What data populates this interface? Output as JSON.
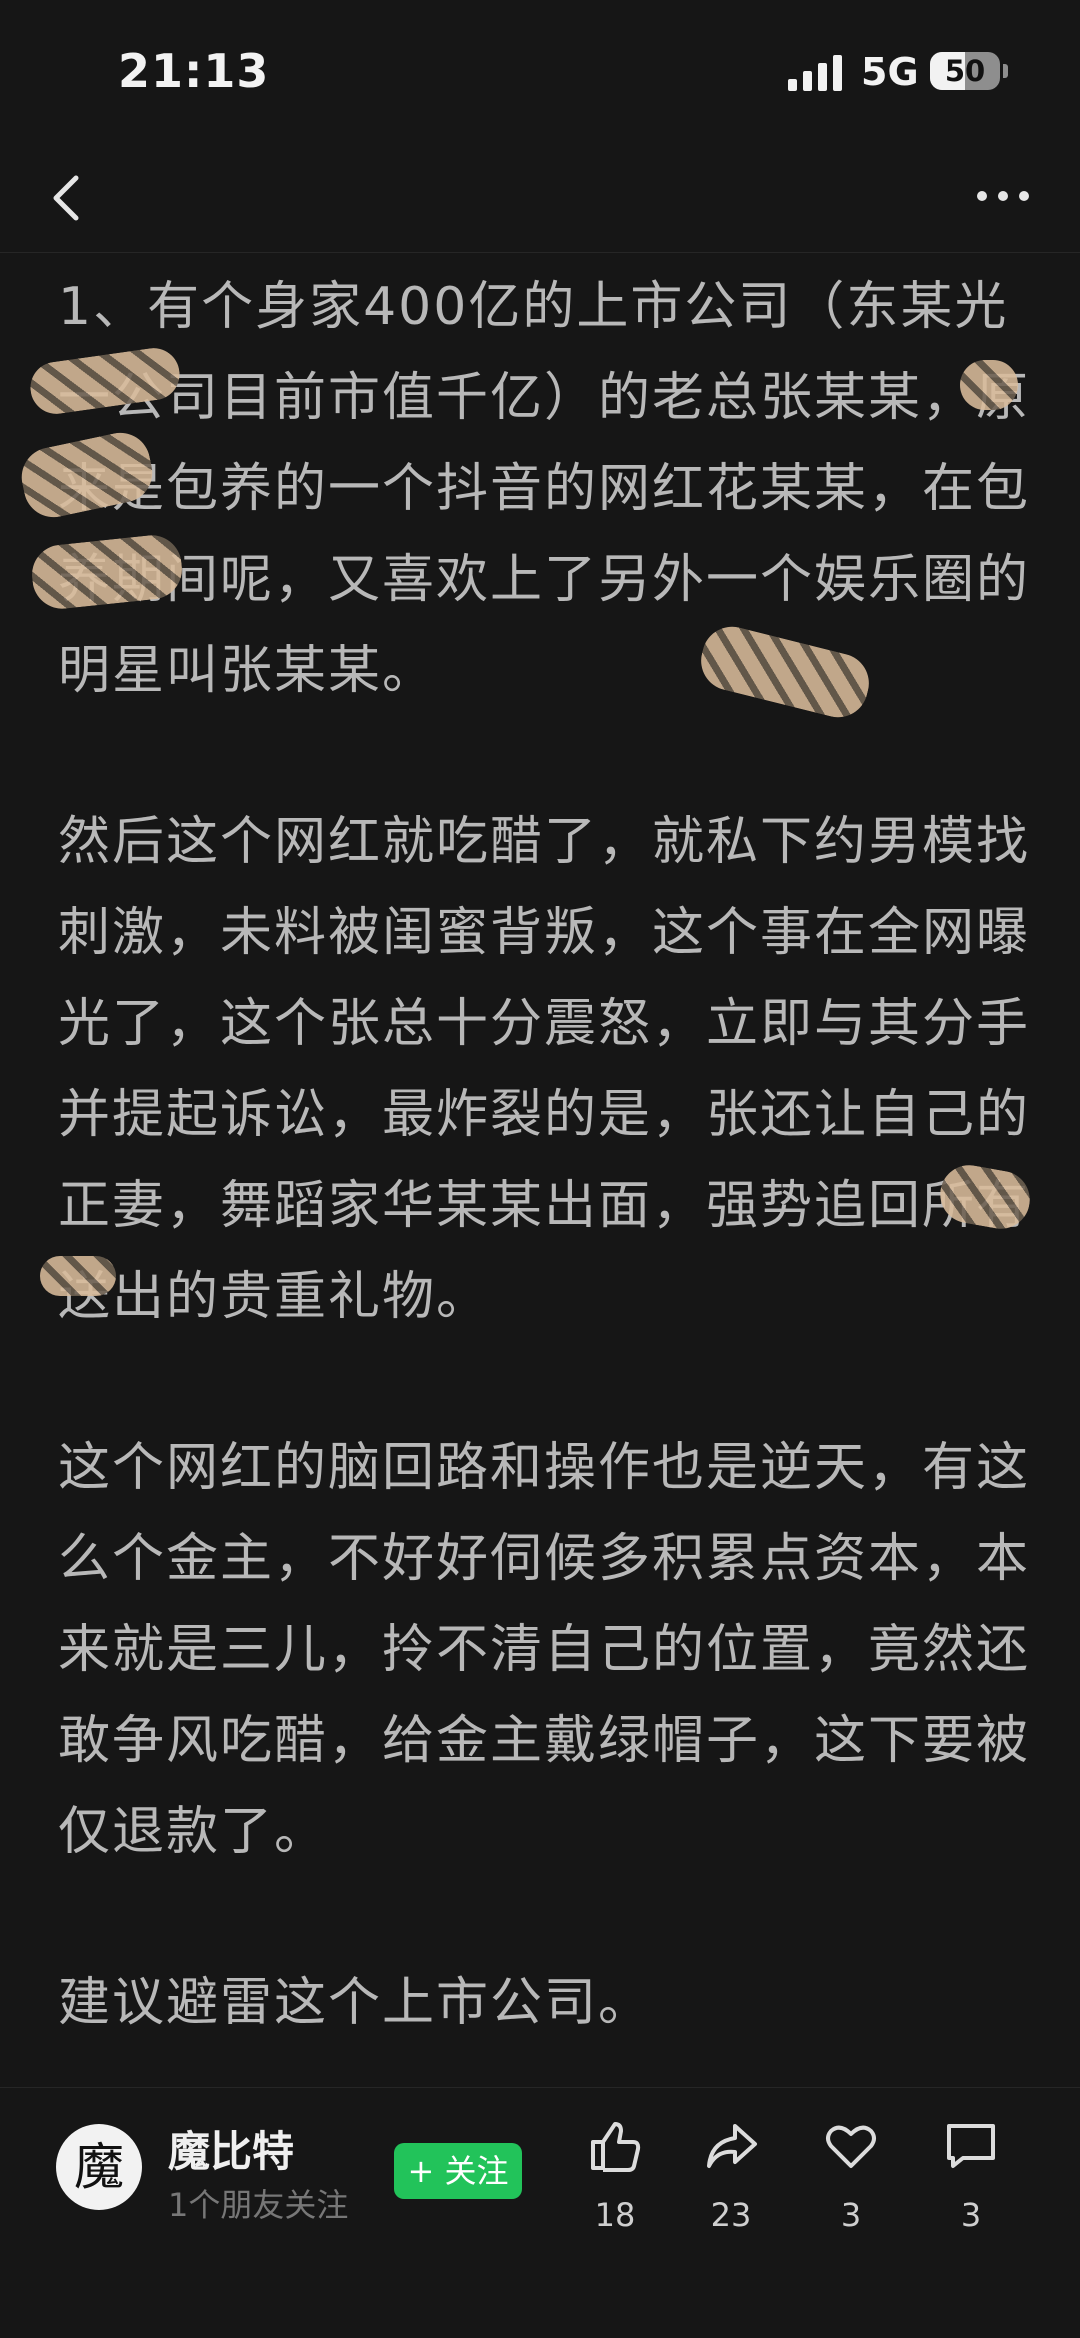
{
  "status_bar": {
    "time": "21:13",
    "network": "5G",
    "battery": "50",
    "battery_level": 0.5
  },
  "nav": {
    "back_icon": "chevron-left-icon",
    "more_icon": "more-dots-icon"
  },
  "article": {
    "paragraphs": [
      "1、有个身家400亿的上市公司（东某光一公司目前市值千亿）的老总张某某，原来是包养的一个抖音的网红花某某，在包养期间呢，又喜欢上了另外一个娱乐圈的明星叫张某某。",
      "然后这个网红就吃醋了，就私下约男模找刺激，未料被闺蜜背叛，这个事在全网曝光了，这个张总十分震怒，立即与其分手并提起诉讼，最炸裂的是，张还让自己的正妻，舞蹈家华某某出面，强势追回所有送出的贵重礼物。",
      "这个网红的脑回路和操作也是逆天，有这么个金主，不好好伺候多积累点资本，本来就是三儿，拎不清自己的位置，竟然还敢争风吃醋，给金主戴绿帽子，这下要被仅退款了。",
      "建议避雷这个上市公司。"
    ]
  },
  "footer": {
    "avatar_text": "魔",
    "author": "魔比特",
    "friends_following": "1个朋友关注",
    "follow_button": "+ 关注",
    "actions": [
      {
        "icon": "thumbs-up-icon",
        "count": "18"
      },
      {
        "icon": "share-icon",
        "count": "23"
      },
      {
        "icon": "heart-icon",
        "count": "3"
      },
      {
        "icon": "comment-icon",
        "count": "3"
      }
    ]
  },
  "colors": {
    "background": "#161616",
    "text": "#b8b8b8",
    "follow_green": "#22c35a"
  }
}
